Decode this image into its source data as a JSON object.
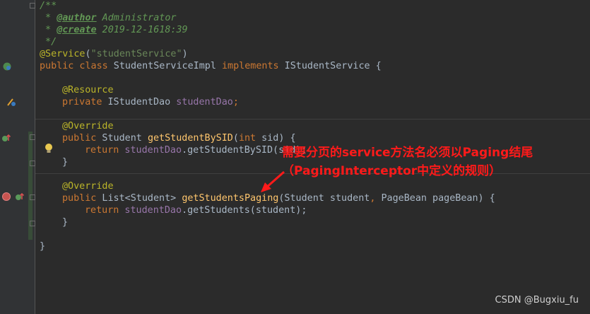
{
  "editor": {
    "lines": {
      "l1": "/**",
      "l2_prefix": " * ",
      "l2_tag": "@author",
      "l2_rest": " Administrator",
      "l3_prefix": " * ",
      "l3_tag": "@create",
      "l3_rest": " 2019-12-1618:39",
      "l4": " */",
      "l5_ann": "@Service",
      "l5_open": "(",
      "l5_str": "\"studentService\"",
      "l5_close": ")",
      "l6_kw1": "public class",
      "l6_name": " StudentServiceImpl ",
      "l6_kw2": "implements",
      "l6_rest": " IStudentService {",
      "l8_ann": "@Resource",
      "l9_kw": "private",
      "l9_type": " IStudentDao ",
      "l9_field": "studentDao",
      "l9_end": ";",
      "l11_ann": "@Override",
      "l12_kw": "public",
      "l12_type": " Student ",
      "l12_method": "getStudentBySID",
      "l12_open": "(",
      "l12_kw2": "int",
      "l12_rest": " sid) {",
      "l13_kw": "return",
      "l13_field": " studentDao",
      "l13_rest": ".getStudentBySID(sid);",
      "l14": "}",
      "l16_ann": "@Override",
      "l17_kw": "public",
      "l17_type": " List<Student> ",
      "l17_method": "getStudentsPaging",
      "l17_p1": "(Student student",
      "l17_comma": ", ",
      "l17_p2": "PageBean pageBean) {",
      "l18_kw": "return",
      "l18_field": " studentDao",
      "l18_rest": ".getStudents(student);",
      "l19": "}",
      "l21": "}"
    }
  },
  "annotation_overlay": {
    "line1": "需要分页的service方法名必须以Paging结尾",
    "line2": "（PagingInterceptor中定义的规则）",
    "color": "#ff1a1a"
  },
  "watermark": "CSDN @Bugxiu_fu",
  "icons": [
    "bean-icon",
    "injection-icon",
    "override-icon",
    "implementing-icon",
    "breakpoint-icon",
    "lightbulb-icon",
    "red-arrow-icon"
  ]
}
